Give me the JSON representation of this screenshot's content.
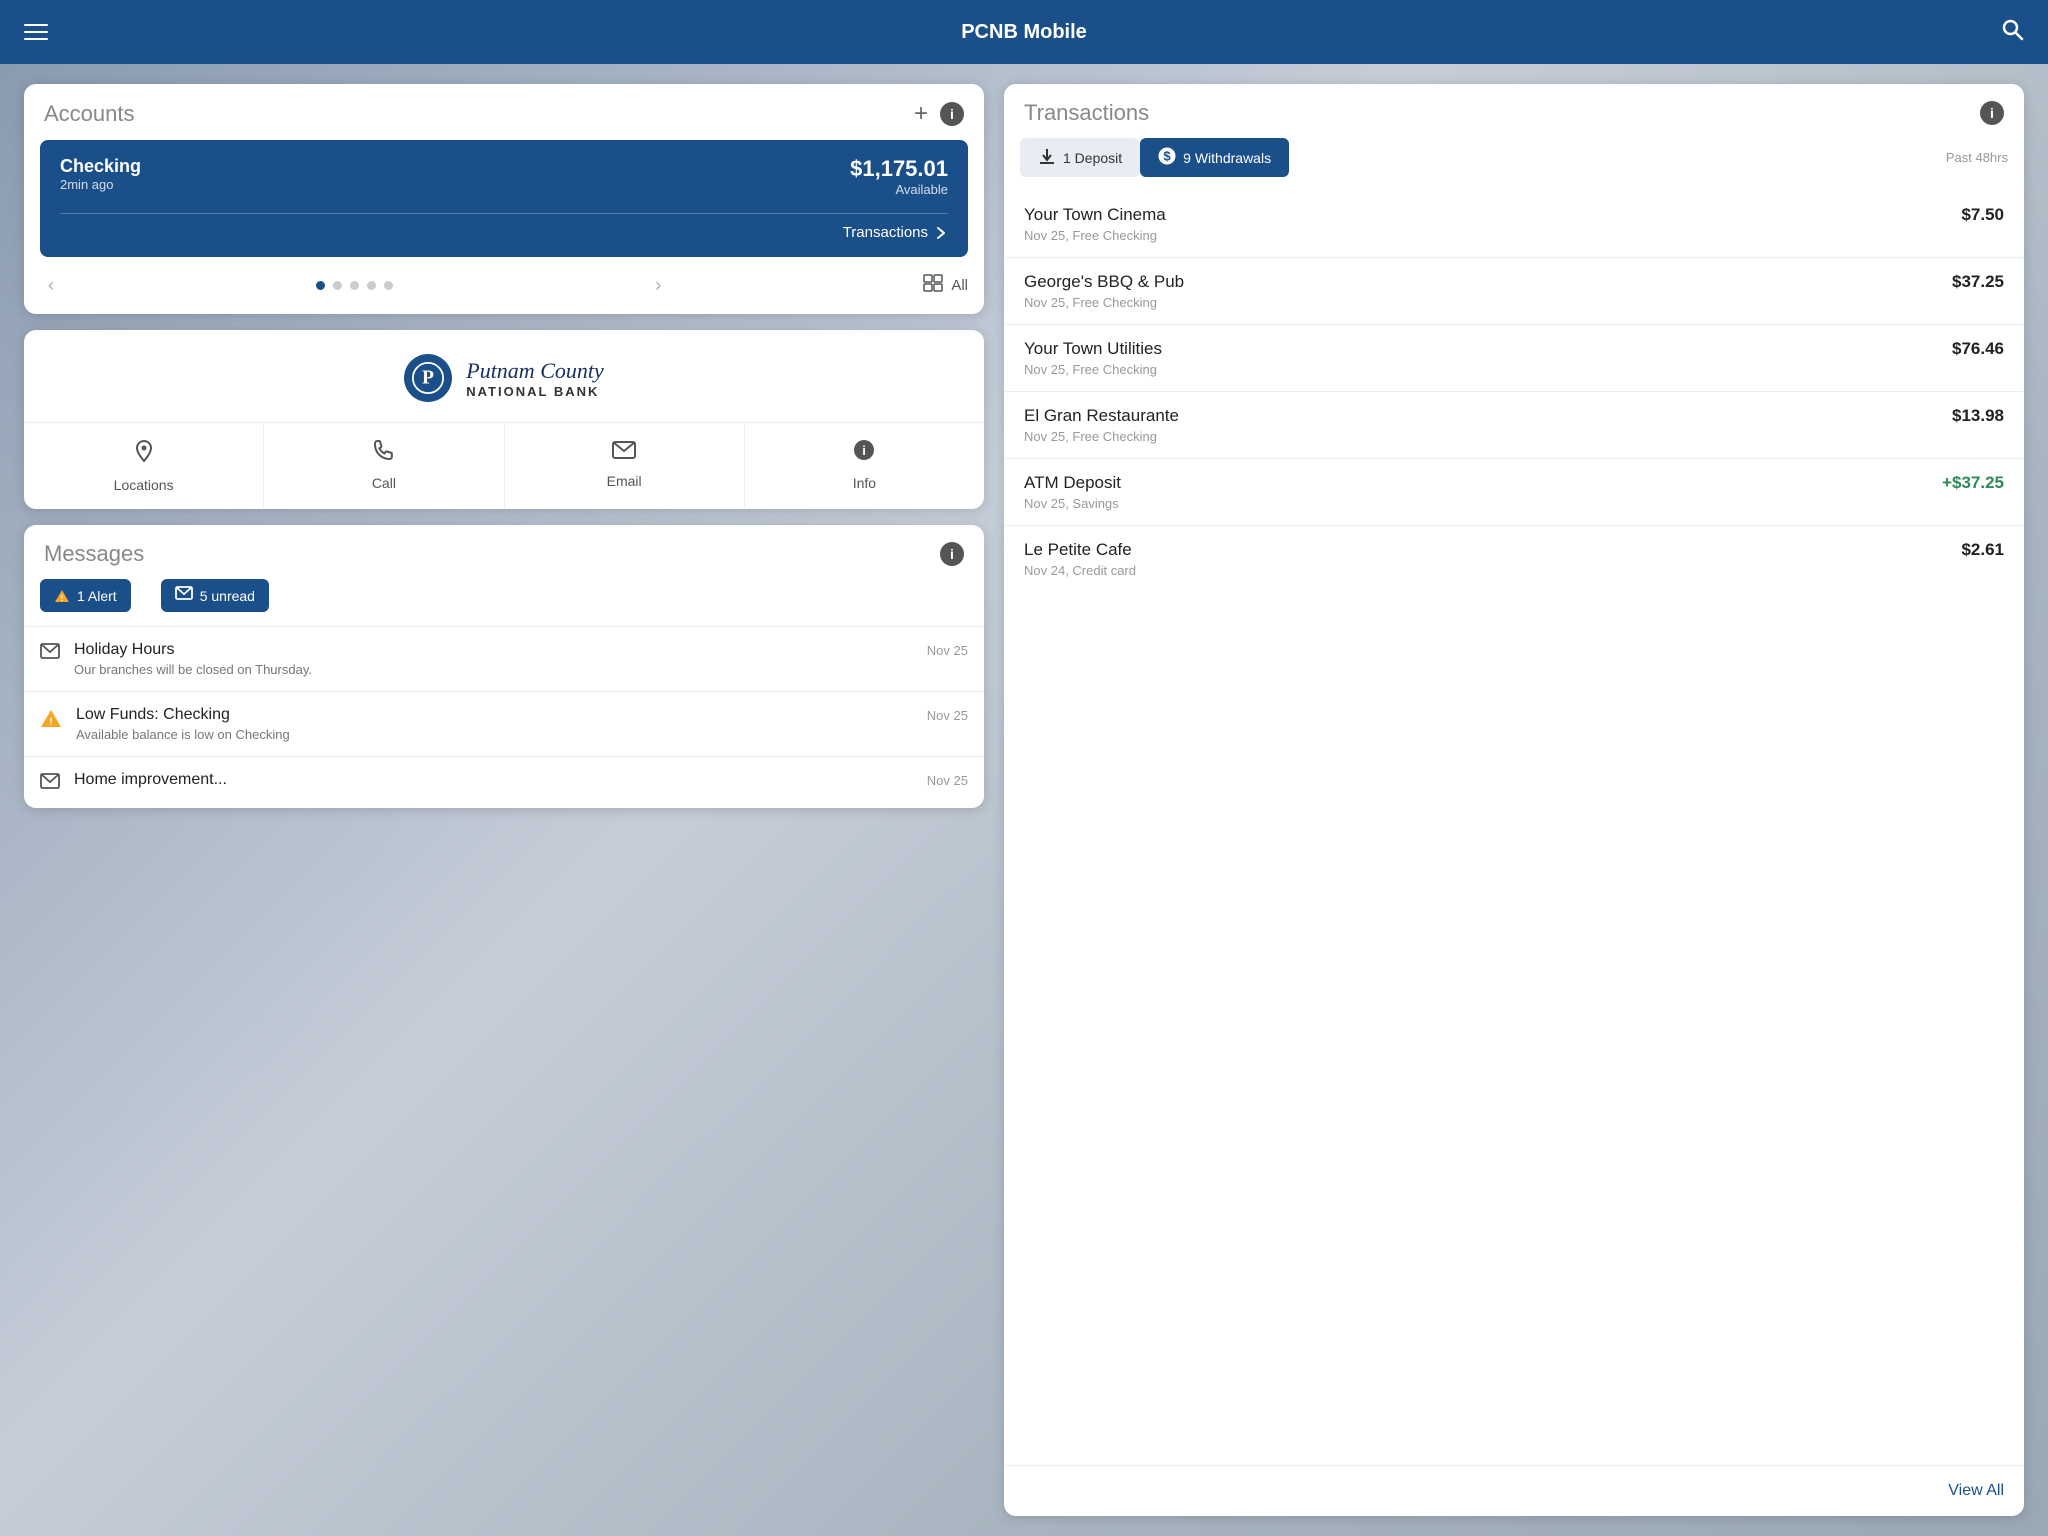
{
  "app": {
    "title": "PCNB Mobile"
  },
  "accounts": {
    "title": "Accounts",
    "add_label": "+",
    "all_label": "All",
    "checking": {
      "name": "Checking",
      "time_ago": "2min ago",
      "amount": "$1,175.01",
      "available_label": "Available",
      "transactions_link": "Transactions"
    },
    "dots": [
      {
        "active": true
      },
      {
        "active": false
      },
      {
        "active": false
      },
      {
        "active": false
      },
      {
        "active": false
      }
    ]
  },
  "bank": {
    "logo_letter": "P",
    "name_main": "Putnam County",
    "name_sub": "NATIONAL BANK",
    "actions": [
      {
        "id": "locations",
        "label": "Locations",
        "icon": "📍"
      },
      {
        "id": "call",
        "label": "Call",
        "icon": "📞"
      },
      {
        "id": "email",
        "label": "Email",
        "icon": "✉️"
      },
      {
        "id": "info",
        "label": "Info",
        "icon": "ℹ️"
      }
    ]
  },
  "messages": {
    "title": "Messages",
    "tabs": [
      {
        "id": "alert",
        "label": "1 Alert",
        "type": "alert"
      },
      {
        "id": "unread",
        "label": "5 unread",
        "type": "unread"
      }
    ],
    "items": [
      {
        "id": "holiday",
        "icon": "envelope",
        "title": "Holiday Hours",
        "date": "Nov 25",
        "body": "Our branches will be closed on Thursday."
      },
      {
        "id": "lowfunds",
        "icon": "warning",
        "title": "Low Funds: Checking",
        "date": "Nov 25",
        "body": "Available balance is low on Checking"
      },
      {
        "id": "home",
        "icon": "envelope",
        "title": "Home improvement...",
        "date": "Nov 25",
        "body": ""
      }
    ]
  },
  "transactions": {
    "title": "Transactions",
    "period": "Past 48hrs",
    "tabs": [
      {
        "id": "deposit",
        "label": "1 Deposit",
        "active": false
      },
      {
        "id": "withdrawals",
        "label": "9 Withdrawals",
        "active": true
      }
    ],
    "items": [
      {
        "name": "Your Town Cinema",
        "sub": "Nov 25, Free Checking",
        "amount": "$7.50",
        "positive": false
      },
      {
        "name": "George's BBQ & Pub",
        "sub": "Nov 25, Free Checking",
        "amount": "$37.25",
        "positive": false
      },
      {
        "name": "Your Town Utilities",
        "sub": "Nov 25, Free Checking",
        "amount": "$76.46",
        "positive": false
      },
      {
        "name": "El Gran Restaurante",
        "sub": "Nov 25, Free Checking",
        "amount": "$13.98",
        "positive": false
      },
      {
        "name": "ATM Deposit",
        "sub": "Nov 25, Savings",
        "amount": "+$37.25",
        "positive": true
      },
      {
        "name": "Le Petite Cafe",
        "sub": "Nov 24, Credit card",
        "amount": "$2.61",
        "positive": false
      }
    ],
    "view_all_label": "View All"
  }
}
